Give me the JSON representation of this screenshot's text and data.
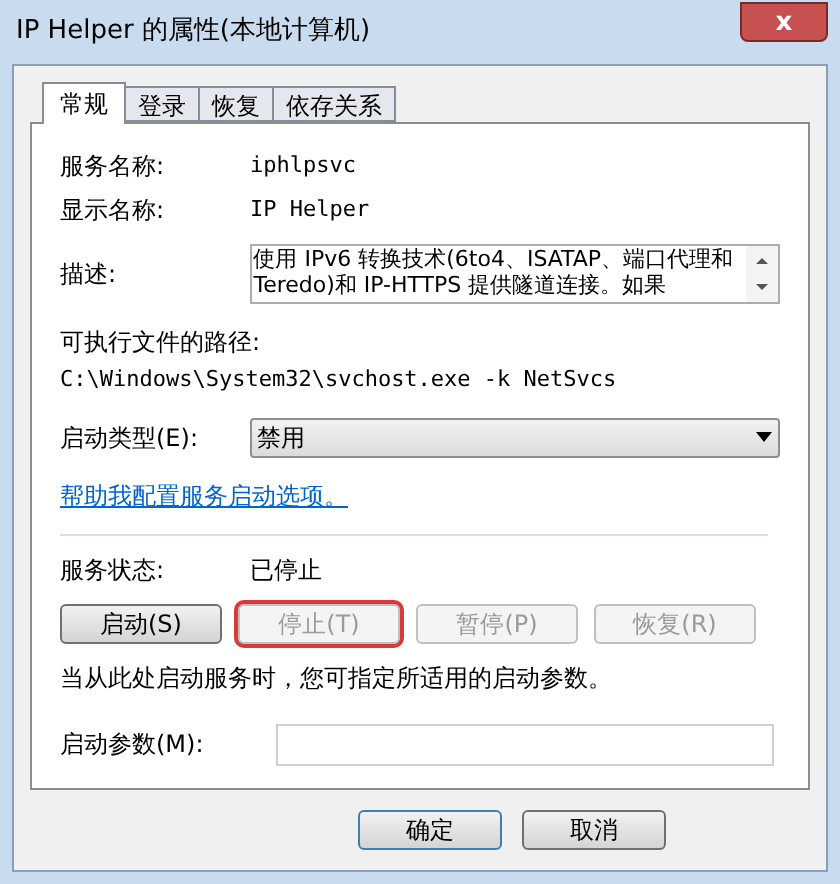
{
  "window": {
    "title": "IP Helper 的属性(本地计算机)",
    "close_label": "x"
  },
  "tabs": [
    {
      "label": "常规",
      "selected": true
    },
    {
      "label": "登录",
      "selected": false
    },
    {
      "label": "恢复",
      "selected": false
    },
    {
      "label": "依存关系",
      "selected": false
    }
  ],
  "service_name": {
    "label": "服务名称:",
    "value": "iphlpsvc"
  },
  "display_name": {
    "label": "显示名称:",
    "value": "IP Helper"
  },
  "description": {
    "label": "描述:",
    "value": "使用 IPv6 转换技术(6to4、ISATAP、端口代理和 Teredo)和 IP-HTTPS 提供隧道连接。如果"
  },
  "path": {
    "label": "可执行文件的路径:",
    "value": "C:\\Windows\\System32\\svchost.exe -k NetSvcs"
  },
  "startup_type": {
    "label": "启动类型(E):",
    "value": "禁用"
  },
  "help_link": "帮助我配置服务启动选项。",
  "service_status": {
    "label": "服务状态:",
    "value": "已停止"
  },
  "control_buttons": [
    {
      "label": "启动(S)",
      "disabled": false,
      "highlighted": false
    },
    {
      "label": "停止(T)",
      "disabled": true,
      "highlighted": true
    },
    {
      "label": "暂停(P)",
      "disabled": true,
      "highlighted": false
    },
    {
      "label": "恢复(R)",
      "disabled": true,
      "highlighted": false
    }
  ],
  "hint": "当从此处启动服务时，您可指定所适用的启动参数。",
  "start_params": {
    "label": "启动参数(M):"
  },
  "dialog_buttons": [
    {
      "label": "确定"
    },
    {
      "label": "取消"
    }
  ]
}
